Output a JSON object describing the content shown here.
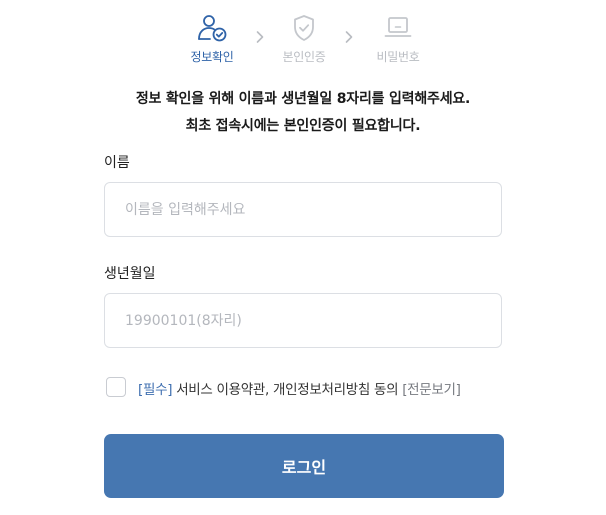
{
  "steps": [
    {
      "label": "정보확인",
      "icon": "user-check-icon",
      "state": "active"
    },
    {
      "label": "본인인증",
      "icon": "shield-check-icon",
      "state": "inactive"
    },
    {
      "label": "비밀번호",
      "icon": "laptop-icon",
      "state": "inactive"
    }
  ],
  "intro": {
    "line1": "정보 확인을 위해 이름과 생년월일 8자리를 입력해주세요.",
    "line2": "최초 접속시에는 본인인증이 필요합니다."
  },
  "name_field": {
    "label": "이름",
    "value": "",
    "placeholder": "이름을 입력해주세요"
  },
  "birth_field": {
    "label": "생년월일",
    "value": "",
    "placeholder": "19900101(8자리)"
  },
  "agreement": {
    "checked": false,
    "required_tag": "[필수]",
    "text": "서비스 이용약관, 개인정보처리방침 동의",
    "full_text_link": "[전문보기]"
  },
  "login_button": {
    "label": "로그인"
  },
  "colors": {
    "accent": "#4677b1",
    "active_step": "#2f63a8",
    "inactive_step": "#b9bcc2",
    "border": "#dcdfe4",
    "placeholder": "#b4b7bd"
  }
}
